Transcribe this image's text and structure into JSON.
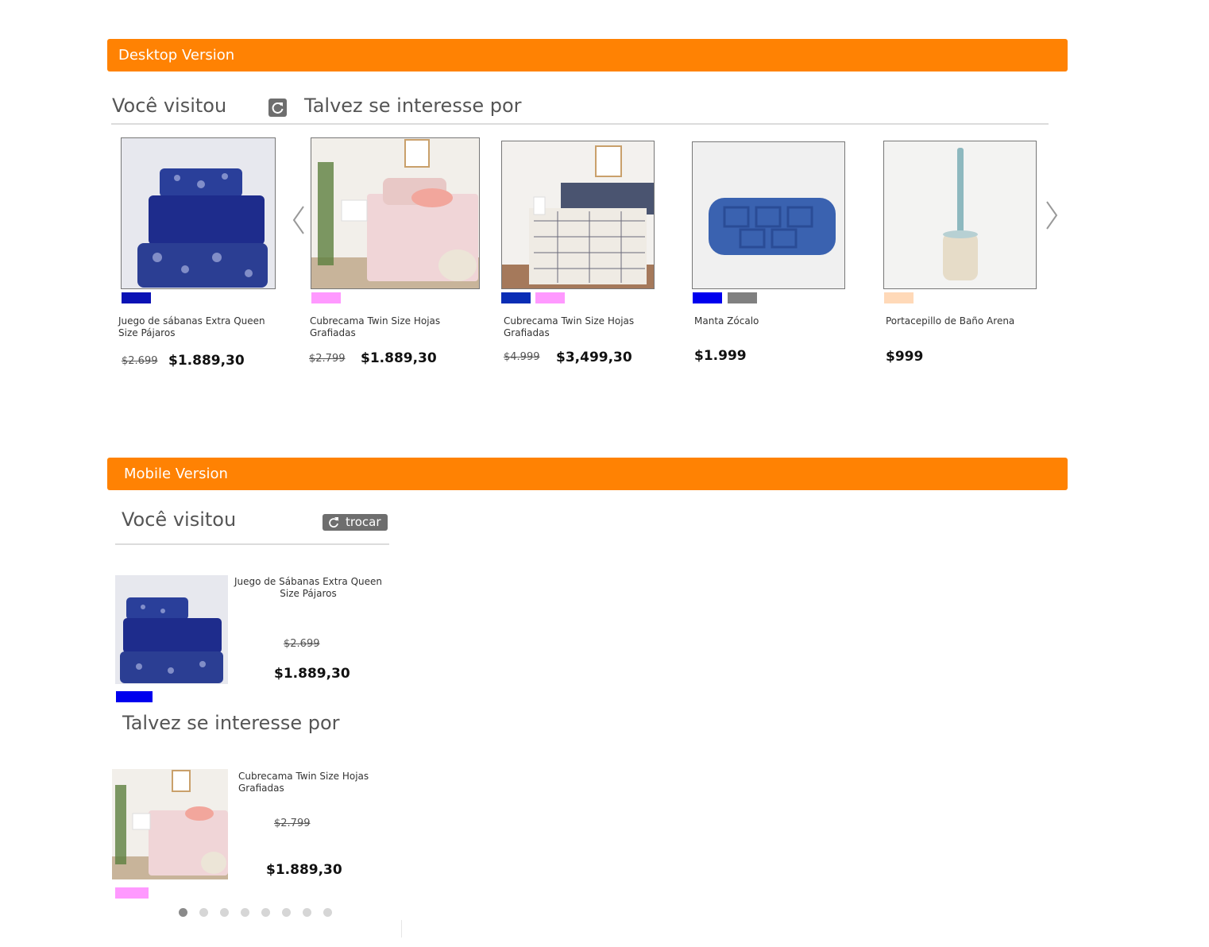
{
  "desktop": {
    "banner": "Desktop Version",
    "visited_title": "Você visitou",
    "interest_title": "Talvez se interesse por",
    "products": [
      {
        "name": "Juego de sábanas Extra Queen Size Pájaros",
        "old_price": "$2.699",
        "price": "$1.889,30",
        "swatches": [
          "#0a12b5"
        ]
      },
      {
        "name": "Cubrecama Twin Size Hojas Grafiadas",
        "old_price": "$2.799",
        "price": "$1.889,30",
        "swatches": [
          "#ff99ff"
        ]
      },
      {
        "name": "Cubrecama Twin Size Hojas Grafiadas",
        "old_price": "$4.999",
        "price": "$3,499,30",
        "swatches": [
          "#0a2db5",
          "#ff99ff"
        ]
      },
      {
        "name": "Manta Zócalo",
        "old_price": "",
        "price": "$1.999",
        "swatches": [
          "#0000ee",
          "#808080"
        ]
      },
      {
        "name": "Portacepillo de Baño Arena",
        "old_price": "",
        "price": "$999",
        "swatches": [
          "#ffd9b8"
        ]
      }
    ]
  },
  "mobile": {
    "banner": "Mobile Version",
    "visited_title": "Você visitou",
    "swap_label": "trocar",
    "interest_title": "Talvez se interesse por",
    "visited_product": {
      "name": "Juego de Sábanas Extra Queen Size Pájaros",
      "old_price": "$2.699",
      "price": "$1.889,30",
      "swatch": "#0000ee"
    },
    "interest_product": {
      "name": "Cubrecama Twin Size Hojas Grafiadas",
      "old_price": "$2.799",
      "price": "$1.889,30",
      "swatch": "#ff99ff"
    },
    "pagination": {
      "total": 8,
      "active": 1
    }
  },
  "icons": {
    "refresh": "refresh-icon",
    "prev": "chevron-left-icon",
    "next": "chevron-right-icon"
  },
  "colors": {
    "banner": "#ff8203",
    "button": "#6e6e6e"
  }
}
